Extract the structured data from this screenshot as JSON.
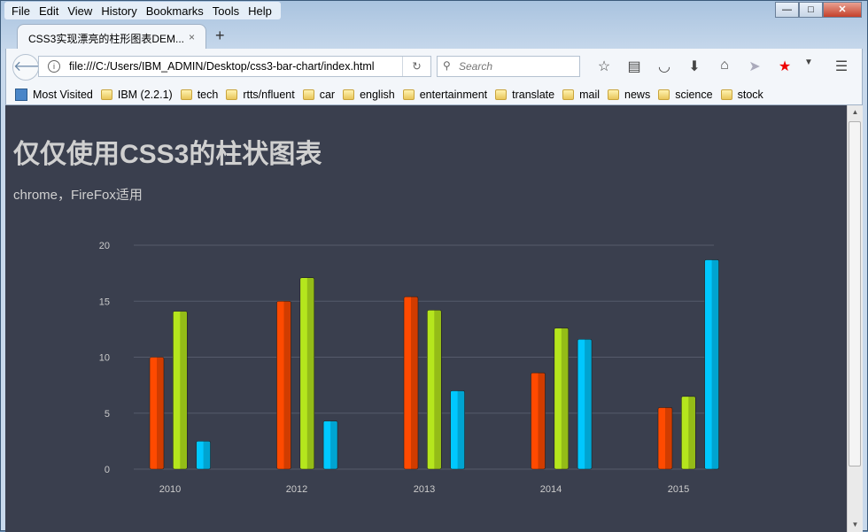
{
  "menu": [
    "File",
    "Edit",
    "View",
    "History",
    "Bookmarks",
    "Tools",
    "Help"
  ],
  "tab": {
    "title": "CSS3实现漂亮的柱形图表DEM...",
    "close": "×",
    "new": "+"
  },
  "nav": {
    "url": "file:///C:/Users/IBM_ADMIN/Desktop/css3-bar-chart/index.html",
    "search_placeholder": "Search"
  },
  "bookmarks": [
    "Most Visited",
    "IBM (2.2.1)",
    "tech",
    "rtts/nfluent",
    "car",
    "english",
    "entertainment",
    "translate",
    "mail",
    "news",
    "science",
    "stock"
  ],
  "page": {
    "title": "仅仅使用CSS3的柱状图表",
    "subtitle": "chrome，FireFox适用"
  },
  "chart_data": {
    "type": "bar",
    "categories": [
      "2010",
      "2012",
      "2013",
      "2014",
      "2015"
    ],
    "series": [
      {
        "values": [
          10,
          15,
          15.4,
          8.6,
          5.5
        ],
        "color": "#ff4a00"
      },
      {
        "values": [
          14.1,
          17.1,
          14.2,
          12.6,
          6.5
        ],
        "color": "#b5e61d"
      },
      {
        "values": [
          2.5,
          4.3,
          7,
          11.6,
          18.7
        ],
        "color": "#00c8ff"
      }
    ],
    "yticks": [
      0,
      5,
      10,
      15,
      20
    ],
    "ylim": [
      0,
      20
    ],
    "grid": true
  }
}
